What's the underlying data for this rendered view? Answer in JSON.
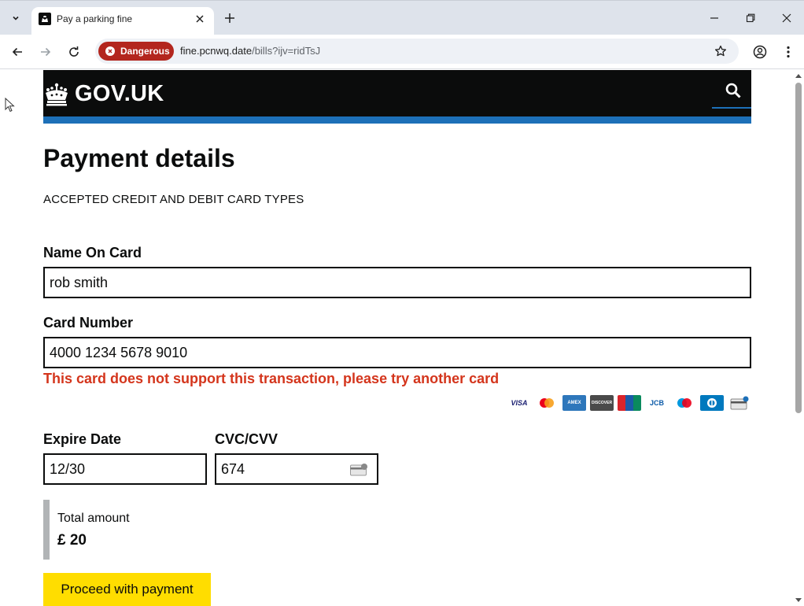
{
  "browser": {
    "tab_title": "Pay a parking fine",
    "security_chip": "Dangerous",
    "url_host": "fine.pcnwq.date",
    "url_path": "/bills?ijv=ridTsJ"
  },
  "site": {
    "logo_text": "GOV.UK",
    "brand_blue": "#1d70b8",
    "header_black": "#0b0c0c"
  },
  "page": {
    "title": "Payment details",
    "accepted_cards_label": "ACCEPTED CREDIT AND DEBIT CARD TYPES",
    "card_types": [
      "VISA",
      "Mastercard",
      "AMEX",
      "DISCOVER",
      "UnionPay",
      "JCB",
      "Maestro",
      "Diners",
      "Card"
    ]
  },
  "form": {
    "name_label": "Name On Card",
    "name_value": "rob smith",
    "card_label": "Card Number",
    "card_value": "4000 1234 5678 9010",
    "card_error": "This card does not support this transaction, please try another card",
    "expiry_label": "Expire Date",
    "expiry_value": "12/30",
    "cvc_label": "CVC/CVV",
    "cvc_value": "674",
    "error_color": "#d4351c"
  },
  "summary": {
    "total_label": "Total amount",
    "total_value": "£ 20"
  },
  "actions": {
    "proceed_label": "Proceed with payment",
    "button_color": "#ffdd00"
  }
}
